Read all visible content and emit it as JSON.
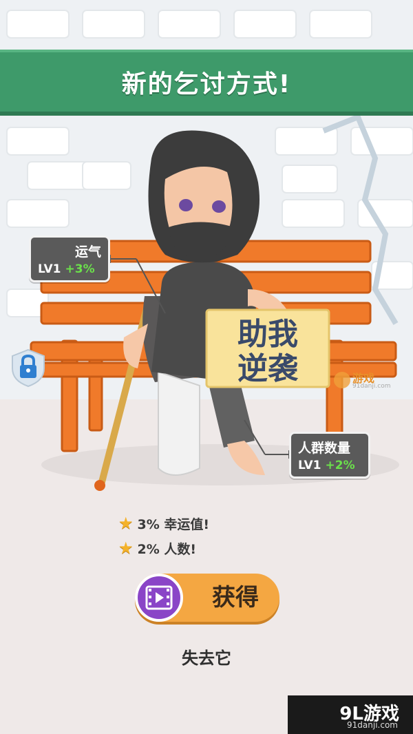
{
  "banner": {
    "title": "新的乞讨方式!"
  },
  "sign": {
    "line1": "助我",
    "line2": "逆袭"
  },
  "stats": {
    "luck": {
      "name": "运气",
      "level_prefix": "LV",
      "level": "1",
      "bonus": "+3%"
    },
    "crowd": {
      "name": "人群数量",
      "level_prefix": "LV",
      "level": "1",
      "bonus": "+2%"
    }
  },
  "perks": [
    {
      "icon": "star-icon",
      "text": "3% 幸运值!"
    },
    {
      "icon": "star-icon",
      "text": "2% 人数!"
    }
  ],
  "actions": {
    "get_label": "获得",
    "get_icon": "video-film-icon",
    "lose_label": "失去它"
  },
  "watermark": {
    "side_brand": "游戏",
    "side_url": "91danji.com",
    "corner_brand": "9L游戏",
    "corner_url": "91danji.com"
  },
  "colors": {
    "banner": "#3e9a6a",
    "bench": "#f07a2a",
    "button": "#f4a742",
    "video_icon_bg": "#8a45c7",
    "bonus_green": "#6be04b",
    "star": "#f4b22a"
  }
}
